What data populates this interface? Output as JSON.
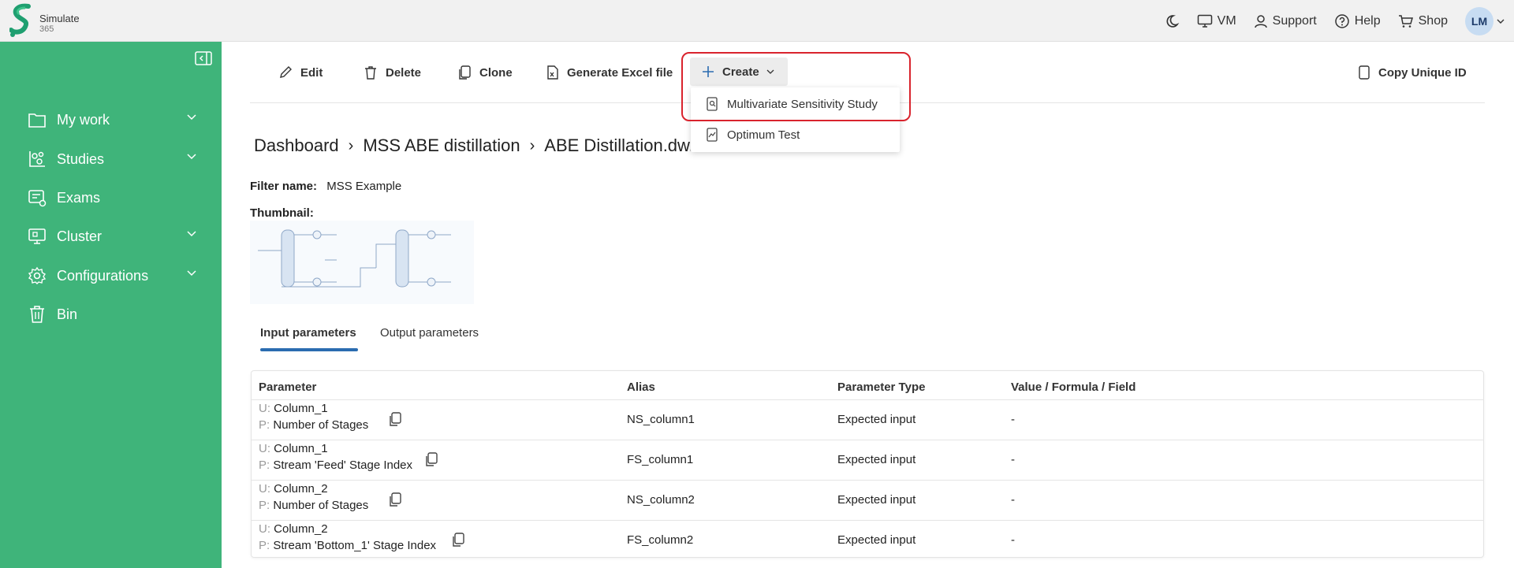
{
  "brand": {
    "name_line1": "Simulate",
    "name_line2": "365"
  },
  "topnav": {
    "vm": "VM",
    "support": "Support",
    "help": "Help",
    "shop": "Shop",
    "avatar_initials": "LM"
  },
  "sidebar": {
    "items": [
      {
        "label": "My work",
        "icon": "folder-icon",
        "expandable": true
      },
      {
        "label": "Studies",
        "icon": "studies-icon",
        "expandable": true
      },
      {
        "label": "Exams",
        "icon": "exam-icon",
        "expandable": false
      },
      {
        "label": "Cluster",
        "icon": "monitor-icon",
        "expandable": true
      },
      {
        "label": "Configurations",
        "icon": "gear-icon",
        "expandable": true
      },
      {
        "label": "Bin",
        "icon": "trash-icon",
        "expandable": false
      }
    ]
  },
  "toolbar": {
    "edit": "Edit",
    "delete": "Delete",
    "clone": "Clone",
    "excel": "Generate Excel file",
    "create": "Create",
    "copy_id": "Copy Unique ID"
  },
  "create_menu": {
    "items": [
      "Multivariate Sensitivity Study",
      "Optimum Test"
    ]
  },
  "breadcrumb": [
    "Dashboard",
    "MSS ABE distillation",
    "ABE Distillation.dw...z > ...s"
  ],
  "filter": {
    "label": "Filter name:",
    "value": "MSS Example"
  },
  "thumbnail_label": "Thumbnail:",
  "tabs": [
    "Input parameters",
    "Output parameters"
  ],
  "table": {
    "headers": [
      "Parameter",
      "Alias",
      "Parameter Type",
      "Value / Formula / Field"
    ],
    "prefix_u": "U:",
    "prefix_p": "P:",
    "rows": [
      {
        "u": "Column_1",
        "p": "Number of Stages",
        "alias": "NS_column1",
        "type": "Expected input",
        "value": "-"
      },
      {
        "u": "Column_1",
        "p": "Stream 'Feed' Stage Index",
        "alias": "FS_column1",
        "type": "Expected input",
        "value": "-"
      },
      {
        "u": "Column_2",
        "p": "Number of Stages",
        "alias": "NS_column2",
        "type": "Expected input",
        "value": "-"
      },
      {
        "u": "Column_2",
        "p": "Stream 'Bottom_1' Stage Index",
        "alias": "FS_column2",
        "type": "Expected input",
        "value": "-"
      }
    ]
  },
  "colors": {
    "sidebar": "#3fb47a",
    "accent": "#2b6cb0",
    "highlight": "#d9232d"
  }
}
